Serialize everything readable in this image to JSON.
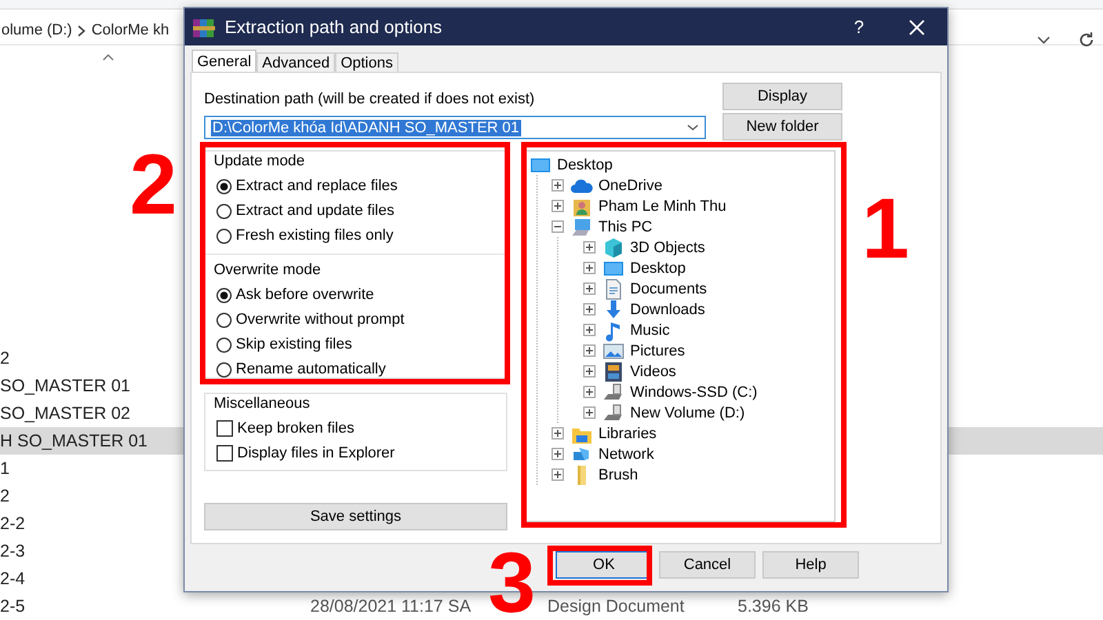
{
  "explorer": {
    "address": {
      "parts": [
        "olume (D:)",
        "ColorMe kh"
      ]
    },
    "rows": [
      {
        "name": "2",
        "selected": false
      },
      {
        "name": "SO_MASTER 01",
        "selected": false
      },
      {
        "name": "SO_MASTER 02",
        "selected": false
      },
      {
        "name": "H SO_MASTER 01",
        "selected": true
      },
      {
        "name": "1",
        "selected": false
      },
      {
        "name": "2",
        "selected": false
      },
      {
        "name": "2-2",
        "selected": false
      },
      {
        "name": "2-3",
        "selected": false
      },
      {
        "name": "2-4",
        "selected": false
      },
      {
        "name": "2-5",
        "selected": false,
        "date": "28/08/2021 11:17 SA",
        "type": "Design Document",
        "size": "5.396 KB"
      }
    ]
  },
  "dialog": {
    "title": "Extraction path and options",
    "help_button": "?",
    "tabs": [
      {
        "label": "General",
        "selected": true
      },
      {
        "label": "Advanced",
        "selected": false
      },
      {
        "label": "Options",
        "selected": false
      }
    ],
    "destination": {
      "label": "Destination path (will be created if does not exist)",
      "value": "D:\\ColorMe khóa Id\\ADANH SO_MASTER 01",
      "text_selected": true
    },
    "side_buttons": [
      "Display",
      "New folder"
    ],
    "groups": [
      {
        "title": "Update mode",
        "kind": "radio",
        "options": [
          {
            "label": "Extract and replace files",
            "selected": true
          },
          {
            "label": "Extract and update files",
            "selected": false
          },
          {
            "label": "Fresh existing files only",
            "selected": false
          }
        ]
      },
      {
        "title": "Overwrite mode",
        "kind": "radio",
        "options": [
          {
            "label": "Ask before overwrite",
            "selected": true
          },
          {
            "label": "Overwrite without prompt",
            "selected": false
          },
          {
            "label": "Skip existing files",
            "selected": false
          },
          {
            "label": "Rename automatically",
            "selected": false
          }
        ]
      },
      {
        "title": "Miscellaneous",
        "kind": "checkbox",
        "options": [
          {
            "label": "Keep broken files",
            "checked": false
          },
          {
            "label": "Display files in Explorer",
            "checked": false
          }
        ]
      }
    ],
    "save_button": "Save settings",
    "tree": [
      {
        "label": "Desktop",
        "kind": "desktop",
        "children": [
          {
            "label": "OneDrive",
            "kind": "cloud",
            "expanded": false
          },
          {
            "label": "Pham Le Minh Thu",
            "kind": "user",
            "expanded": false
          },
          {
            "label": "This PC",
            "kind": "pc",
            "expanded": true,
            "children": [
              {
                "label": "3D Objects",
                "kind": "cube",
                "expanded": false
              },
              {
                "label": "Desktop",
                "kind": "desktop",
                "expanded": false
              },
              {
                "label": "Documents",
                "kind": "documents",
                "expanded": false
              },
              {
                "label": "Downloads",
                "kind": "download",
                "expanded": false
              },
              {
                "label": "Music",
                "kind": "music",
                "expanded": false
              },
              {
                "label": "Pictures",
                "kind": "pictures",
                "expanded": false
              },
              {
                "label": "Videos",
                "kind": "videos",
                "expanded": false
              },
              {
                "label": "Windows-SSD (C:)",
                "kind": "drive",
                "expanded": false
              },
              {
                "label": "New Volume (D:)",
                "kind": "drive",
                "expanded": false
              }
            ]
          },
          {
            "label": "Libraries",
            "kind": "library",
            "expanded": false
          },
          {
            "label": "Network",
            "kind": "network",
            "expanded": false
          },
          {
            "label": "Brush",
            "kind": "folder",
            "expanded": false
          }
        ]
      }
    ],
    "buttons": [
      {
        "label": "OK",
        "default": true
      },
      {
        "label": "Cancel",
        "default": false
      },
      {
        "label": "Help",
        "default": false
      }
    ]
  },
  "annotations": [
    {
      "number": "2"
    },
    {
      "number": "1"
    },
    {
      "number": "3"
    }
  ]
}
